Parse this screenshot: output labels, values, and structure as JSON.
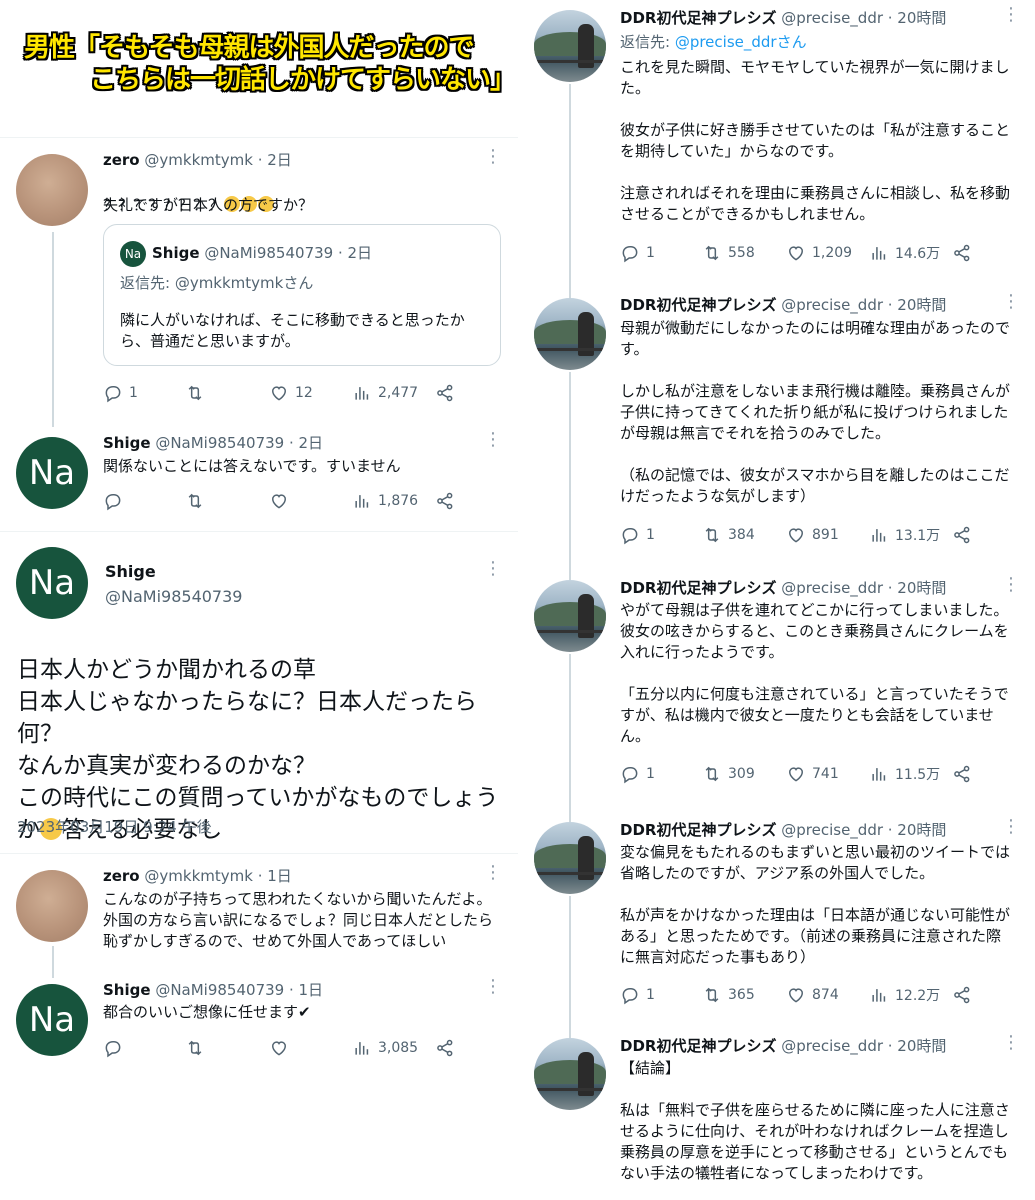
{
  "caption": {
    "line1": "男性「そもそも母親は外国人だったので",
    "line2": "こちらは一切話しかけてすらいない」"
  },
  "left": {
    "tweet1": {
      "name": "zero",
      "meta": "@ymkkmtymk · 2日",
      "line1": "？？？？？？？？",
      "line2": "失礼ですが日本人の方ですか？",
      "quote": {
        "avatar_text": "Na",
        "name": "Shige",
        "meta": "@NaMi98540739 · 2日",
        "reply_to": "返信先: @ymkkmtymkさん",
        "text": "隣に人がいなければ、そこに移動できると思ったか\nら、普通だと思いますが。"
      },
      "replies": "1",
      "likes": "12",
      "views": "2,477"
    },
    "tweet2": {
      "avatar_text": "Na",
      "name": "Shige",
      "meta": "@NaMi98540739 · 2日",
      "text": "関係ないことには答えないです。すいません",
      "views": "1,876"
    },
    "main_tweet": {
      "avatar_text": "Na",
      "name": "Shige",
      "handle": "@NaMi98540739",
      "text": "日本人かどうか聞かれるの草\n日本人じゃなかったらなに？日本人だったら\n何？\nなんか真実が変わるのかな？\nこの時代にこの質問っていかがなものでしょう",
      "text_last": "か",
      "text_tail": "答える必要なし",
      "timestamp": "2023年03月19日 9:24 午後"
    },
    "tweet3": {
      "name": "zero",
      "meta": "@ymkkmtymk · 1日",
      "text": "こんなのが子持ちって思われたくないから聞いたんだよ。\n外国の方なら言い訳になるでしょ？同じ日本人だとしたら\n恥ずかしすぎるので、せめて外国人であってほしい"
    },
    "tweet4": {
      "avatar_text": "Na",
      "name": "Shige",
      "meta": "@NaMi98540739 · 1日",
      "text": "都合のいいご想像に任せます✔",
      "views": "3,085"
    }
  },
  "right": {
    "name": "DDR初代足神プレシズ",
    "meta": "@precise_ddr · 20時間",
    "tweets": [
      {
        "reply_to_prefix": "返信先: ",
        "reply_to_mention": "@precise_ddrさん",
        "text": "これを見た瞬間、モヤモヤしていた視界が一気に開けまし\nた。\n\n彼女が子供に好き勝手させていたのは「私が注意すること\nを期待していた」からなのです。\n\n注意されればそれを理由に乗務員さんに相談し、私を移動\nさせることができるかもしれません。",
        "replies": "1",
        "retweets": "558",
        "likes": "1,209",
        "views": "14.6万"
      },
      {
        "text": "母親が微動だにしなかったのには明確な理由があったので\nす。\n\nしかし私が注意をしないまま飛行機は離陸。乗務員さんが\n子供に持ってきてくれた折り紙が私に投げつけられました\nが母親は無言でそれを拾うのみでした。\n\n（私の記憶では、彼女がスマホから目を離したのはここだ\nけだったような気がします）",
        "replies": "1",
        "retweets": "384",
        "likes": "891",
        "views": "13.1万"
      },
      {
        "text": "やがて母親は子供を連れてどこかに行ってしまいました。\n彼女の呟きからすると、このとき乗務員さんにクレームを\n入れに行ったようです。\n\n「五分以内に何度も注意されている」と言っていたそうで\nすが、私は機内で彼女と一度たりとも会話をしていませ\nん。",
        "replies": "1",
        "retweets": "309",
        "likes": "741",
        "views": "11.5万"
      },
      {
        "text": "変な偏見をもたれるのもまずいと思い最初のツイートでは\n省略したのですが、アジア系の外国人でした。\n\n私が声をかけなかった理由は「日本語が通じない可能性が\nある」と思ったためです。（前述の乗務員に注意された際\nに無言対応だった事もあり）",
        "replies": "1",
        "retweets": "365",
        "likes": "874",
        "views": "12.2万"
      },
      {
        "text": "【結論】\n\n私は「無料で子供を座らせるために隣に座った人に注意さ\nせるように仕向け、それが叶わなければクレームを捏造し\n乗務員の厚意を逆手にとって移動させる」というとんでも\nない手法の犠牲者になってしまったわけです。"
      }
    ]
  }
}
